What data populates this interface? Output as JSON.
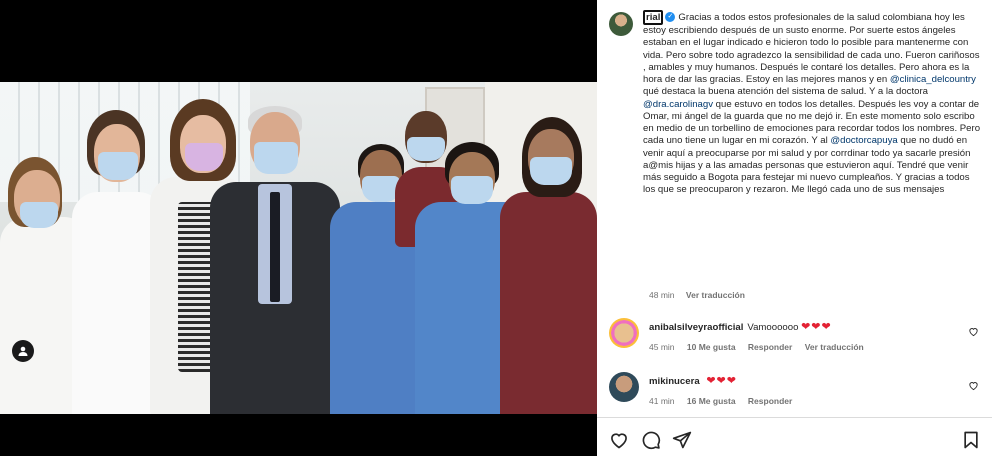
{
  "post": {
    "username": "rial",
    "verified_mark": "✓",
    "caption_segments": [
      {
        "type": "text",
        "text": "Gracias a todos estos profesionales de la salud colombiana hoy les estoy escribiendo después de un susto enorme. Por suerte estos ángeles estaban en el lugar indicado e hicieron todo lo posible para mantenerme con vida. Pero sobre todo agradezco la sensibilidad de cada uno. Fueron cariñosos , amables y muy humanos. Después le contaré los detalles. Pero ahora es la hora de dar las gracias. Estoy en las mejores manos y en "
      },
      {
        "type": "mention",
        "text": "@clinica_delcountry"
      },
      {
        "type": "text",
        "text": " qué destaca la buena atención del sistema de salud. Y a la doctora "
      },
      {
        "type": "mention",
        "text": "@dra.carolinagv"
      },
      {
        "type": "text",
        "text": " que estuvo en todos los detalles. Después les voy a contar de Omar, mi ángel de la guarda que no me dejó ir. En este momento solo escribo en medio de un torbellino de emociones para recordar todos los nombres. Pero cada uno tiene un lugar en mi corazón. Y al "
      },
      {
        "type": "mention",
        "text": "@doctorcapuya"
      },
      {
        "type": "text",
        "text": " que no dudó en venir aquí a preocuparse por mi salud y por corrdinar todo ya sacarle presión a@mis hijas y a las amadas personas que estuvieron aquí. Tendré que venir más seguido a Bogota para festejar mi nuevo cumpleaños. Y gracias a todos los que se preocuparon y rezaron. Me llegó cada uno de sus mensajes"
      }
    ],
    "time": "48 min",
    "translate_label": "Ver traducción"
  },
  "comments": [
    {
      "username": "anibalsilveyraofficial",
      "text": "Vamoooooo",
      "hearts": "❤❤❤",
      "time": "45 min",
      "likes": "10 Me gusta",
      "reply": "Responder",
      "translate": "Ver traducción"
    },
    {
      "username": "mikinucera",
      "text": "",
      "hearts": "❤❤❤",
      "time": "41 min",
      "likes": "16 Me gusta",
      "reply": "Responder"
    }
  ],
  "icons": {
    "like": "heart-icon",
    "comment": "comment-icon",
    "share": "send-icon",
    "save": "bookmark-icon",
    "tag": "user-tag-icon"
  },
  "colors": {
    "mention": "#00376b",
    "verified": "#1f8ef1",
    "heart": "#e32234",
    "meta": "#737373"
  }
}
